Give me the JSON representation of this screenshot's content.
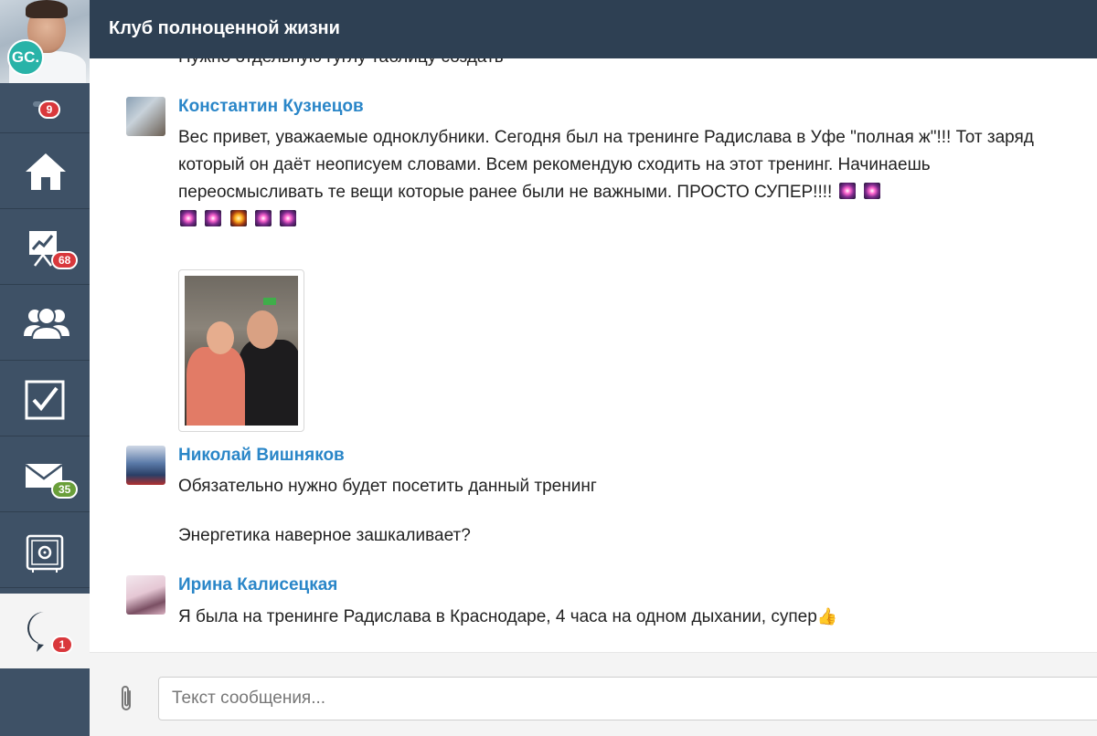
{
  "header": {
    "title": "Клуб полноценной жизни"
  },
  "profile": {
    "initials": "GC."
  },
  "sidebar": {
    "notifications_count": "9",
    "items": [
      {
        "name": "home",
        "badge": ""
      },
      {
        "name": "stats",
        "badge": "68"
      },
      {
        "name": "people",
        "badge": ""
      },
      {
        "name": "tasks",
        "badge": ""
      },
      {
        "name": "mail",
        "badge": "35"
      },
      {
        "name": "safe",
        "badge": ""
      },
      {
        "name": "chat",
        "badge": "1"
      }
    ]
  },
  "feed": {
    "clipped_text": "Нужно отдельную гуглу таблицу создать",
    "messages": [
      {
        "author": "Константин Кузнецов",
        "text": "Вес привет, уважаемые одноклубники. Сегодня был на тренинге Радислава в Уфе \"полная ж\"!!! Тот заряд который он даёт неописуем словами. Всем рекомендую сходить на этот тренинг. Начинаешь переосмысливать те вещи которые ранее были не важными. ПРОСТО СУПЕР!!!!"
      },
      {
        "author": "Николай Вишняков",
        "text": "Обязательно нужно будет посетить данный тренинг",
        "text2": "Энергетика наверное зашкаливает?"
      },
      {
        "author": "Ирина Калисецкая",
        "text": "Я была на тренинге Радислава в Краснодаре, 4 часа на одном дыхании, супер"
      }
    ]
  },
  "composer": {
    "placeholder": "Текст сообщения..."
  },
  "colors": {
    "sidebar": "#3e5166",
    "header": "#2e4053",
    "author": "#2a86c8",
    "badge_red": "#d9383c",
    "badge_green": "#6a9f3a"
  }
}
